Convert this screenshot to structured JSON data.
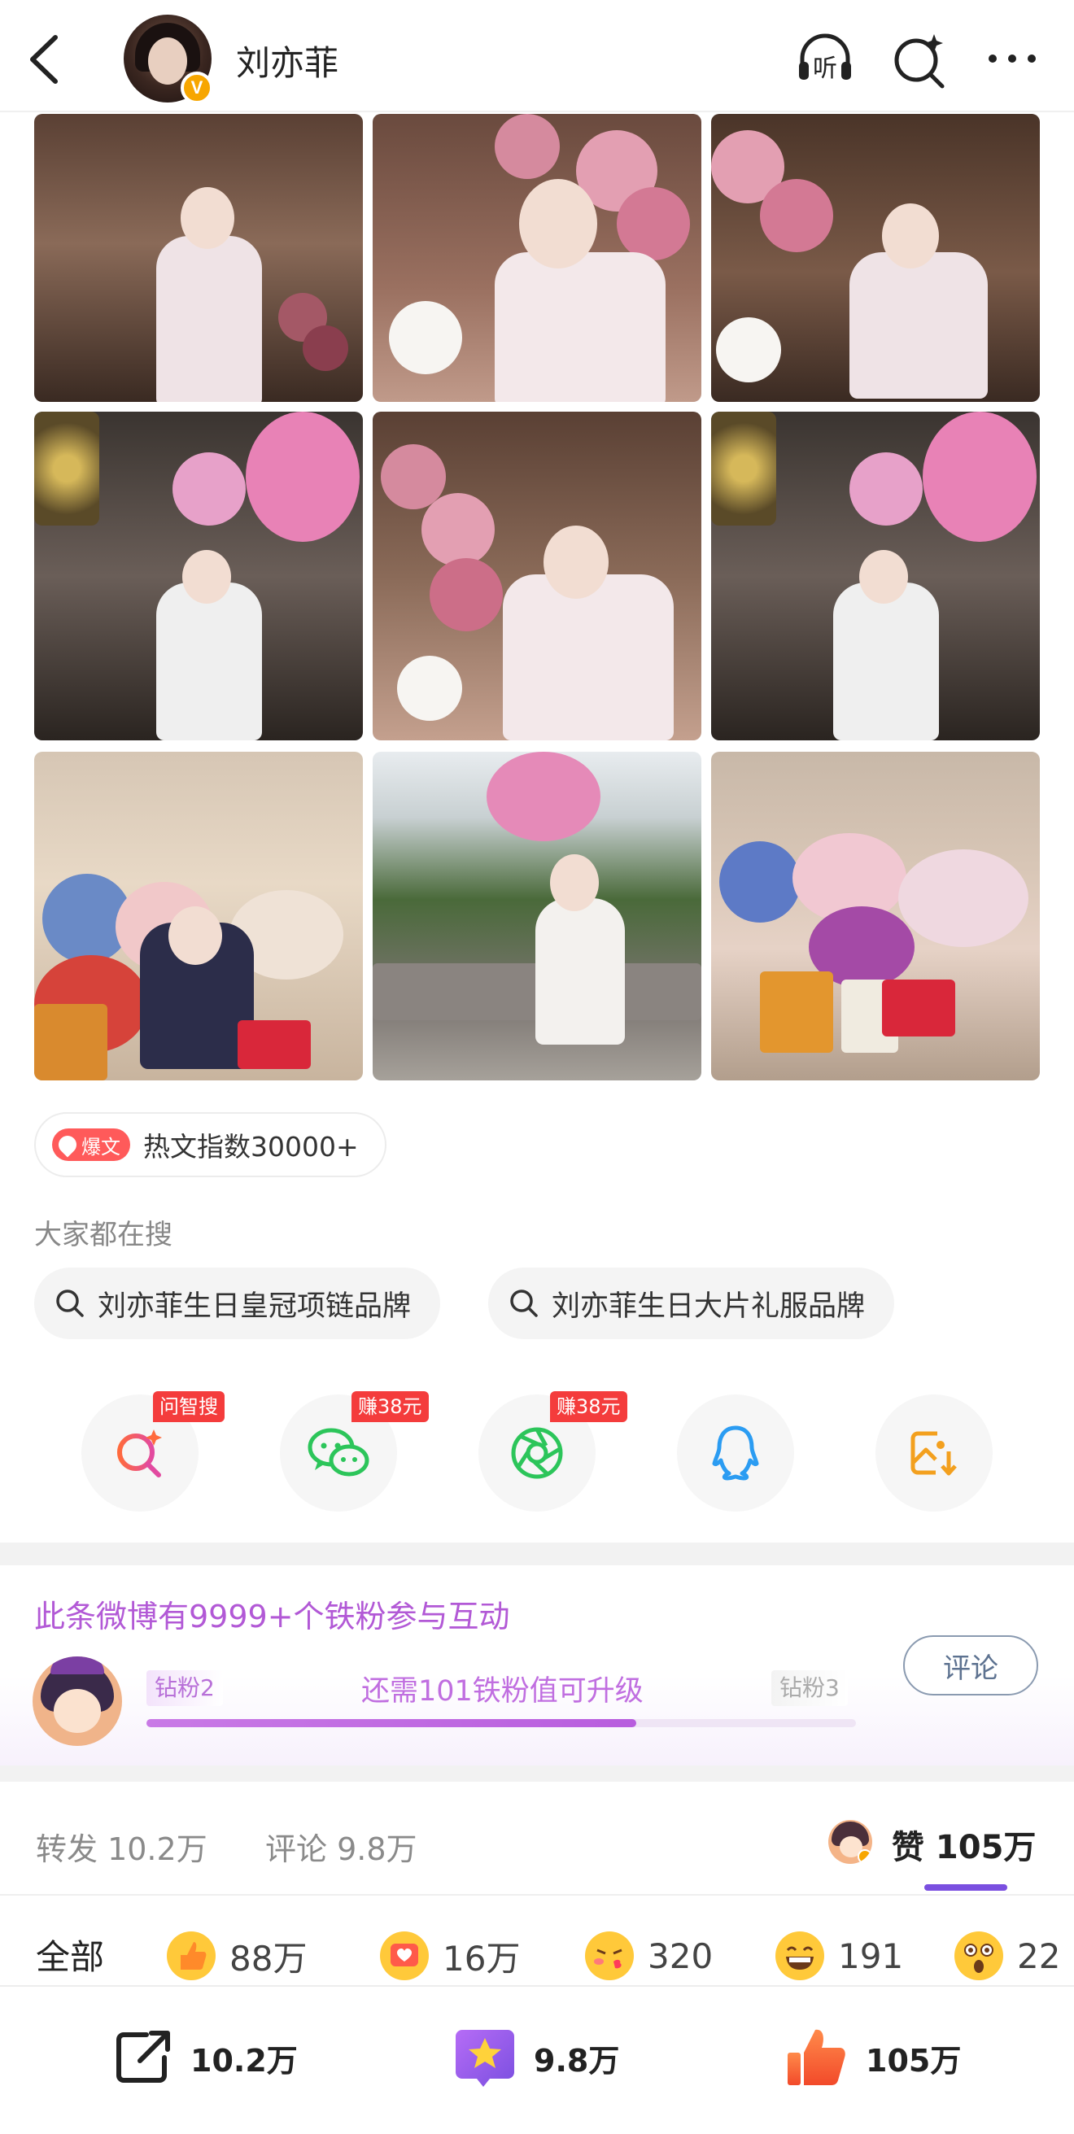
{
  "header": {
    "username": "刘亦菲",
    "verified_badge": "V",
    "icons": [
      "back-arrow-icon",
      "listen-icon",
      "search-sparkle-icon",
      "more-icon"
    ],
    "listen_label": "听"
  },
  "hot": {
    "badge": "爆文",
    "text": "热文指数30000+"
  },
  "searches": {
    "title": "大家都在搜",
    "items": [
      "刘亦菲生日皇冠项链品牌",
      "刘亦菲生日大片礼服品牌"
    ]
  },
  "share": {
    "items": [
      {
        "name": "ask-search",
        "icon": "search-ai-icon",
        "tag": "问智搜"
      },
      {
        "name": "wechat",
        "icon": "wechat-icon",
        "tag": "赚38元"
      },
      {
        "name": "moments",
        "icon": "moments-icon",
        "tag": "赚38元"
      },
      {
        "name": "qq",
        "icon": "qq-icon",
        "tag": ""
      },
      {
        "name": "save-image",
        "icon": "save-image-icon",
        "tag": ""
      }
    ]
  },
  "fans": {
    "title": "此条微博有9999+个铁粉参与互动",
    "level_current": "钻粉2",
    "level_next": "钻粉3",
    "hint": "还需101铁粉值可升级",
    "progress": 0.69,
    "comment_button": "评论"
  },
  "stats": {
    "repost": "转发 10.2万",
    "comment": "评论 9.8万",
    "like": "赞 105万"
  },
  "reactions": {
    "all": "全部",
    "items": [
      {
        "icon": "thumbs-up-emoji-icon",
        "count": "88万"
      },
      {
        "icon": "heart-emoji-icon",
        "count": "16万"
      },
      {
        "icon": "kiss-emoji-icon",
        "count": "320"
      },
      {
        "icon": "grin-emoji-icon",
        "count": "191"
      },
      {
        "icon": "surprised-emoji-icon",
        "count": "22"
      }
    ]
  },
  "bottom": {
    "share_count": "10.2万",
    "comment_count": "9.8万",
    "like_count": "105万"
  },
  "colors": {
    "accent_purple": "#b259d6",
    "hot_red": "#ff5a5a",
    "like_orange": "#ff6b3d",
    "verified": "#f7a600"
  }
}
